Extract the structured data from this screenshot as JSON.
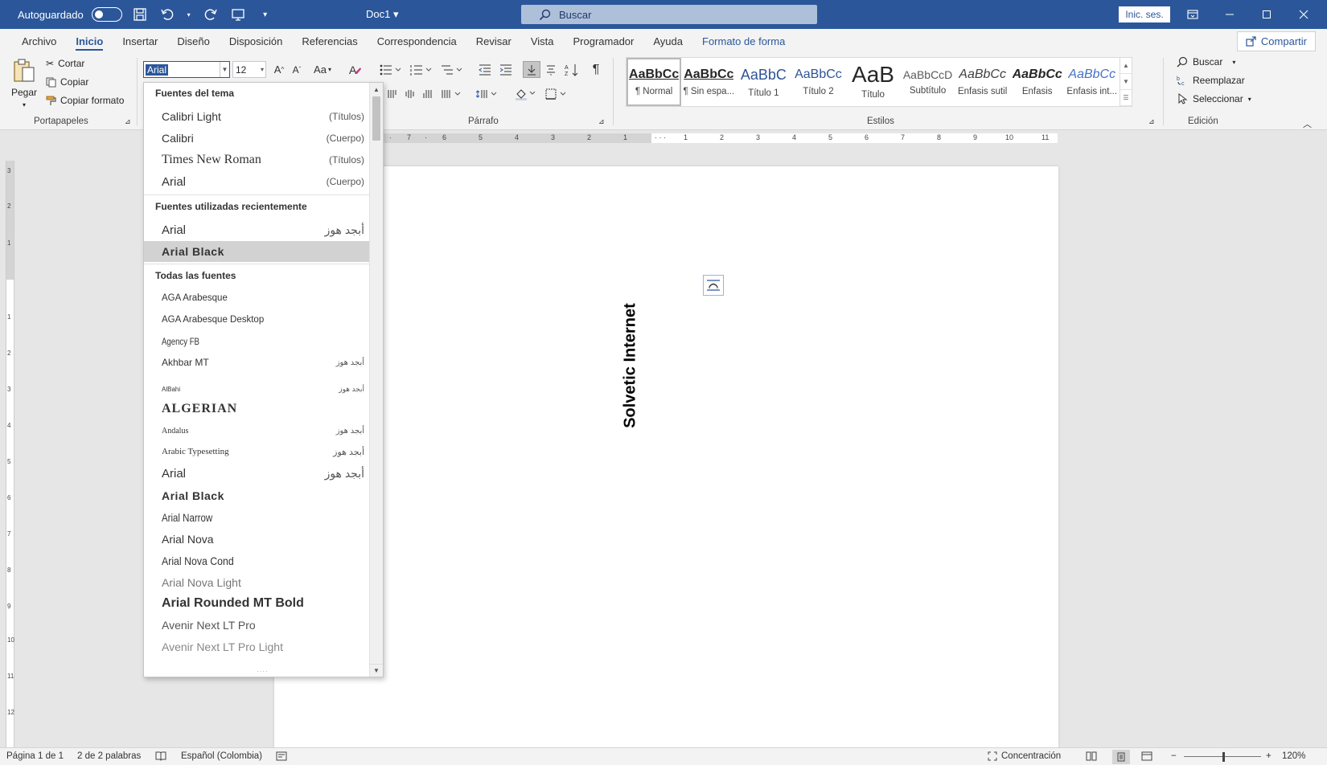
{
  "titlebar": {
    "autosave_label": "Autoguardado",
    "doc_title": "Doc1",
    "search_label": "Buscar",
    "signin_label": "Inic. ses."
  },
  "tabs": {
    "items": [
      "Archivo",
      "Inicio",
      "Insertar",
      "Diseño",
      "Disposición",
      "Referencias",
      "Correspondencia",
      "Revisar",
      "Vista",
      "Programador",
      "Ayuda",
      "Formato de forma"
    ],
    "share_label": "Compartir"
  },
  "ribbon": {
    "clipboard": {
      "paste": "Pegar",
      "cut": "Cortar",
      "copy": "Copiar",
      "format_painter": "Copiar formato",
      "label": "Portapapeles"
    },
    "font": {
      "current_font": "Arial",
      "current_size": "12",
      "change_case": "Aa"
    },
    "paragraph_label": "Párrafo",
    "styles": {
      "label": "Estilos",
      "items": [
        {
          "preview": "AaBbCc",
          "name": "¶ Normal"
        },
        {
          "preview": "AaBbCc",
          "name": "¶ Sin espa..."
        },
        {
          "preview": "AaBbC",
          "name": "Título 1"
        },
        {
          "preview": "AaBbCc",
          "name": "Título 2"
        },
        {
          "preview": "AaB",
          "name": "Título"
        },
        {
          "preview": "AaBbCcD",
          "name": "Subtítulo"
        },
        {
          "preview": "AaBbCc",
          "name": "Énfasis sutil"
        },
        {
          "preview": "AaBbCc",
          "name": "Énfasis"
        },
        {
          "preview": "AaBbCc",
          "name": "Énfasis int..."
        }
      ]
    },
    "editing": {
      "find": "Buscar",
      "replace": "Reemplazar",
      "select": "Seleccionar",
      "label": "Edición"
    }
  },
  "font_dropdown": {
    "theme_header": "Fuentes del tema",
    "theme_fonts": [
      {
        "name": "Calibri Light",
        "tag": "(Títulos)"
      },
      {
        "name": "Calibri",
        "tag": "(Cuerpo)"
      },
      {
        "name": "Times New Roman",
        "tag": "(Títulos)"
      },
      {
        "name": "Arial",
        "tag": "(Cuerpo)"
      }
    ],
    "recent_header": "Fuentes utilizadas recientemente",
    "recent_fonts": [
      {
        "name": "Arial",
        "tag": "أبجد هوز"
      },
      {
        "name": "Arial Black",
        "tag": ""
      }
    ],
    "all_header": "Todas las fuentes",
    "all_fonts": [
      {
        "name": "AGA Arabesque",
        "tag": ""
      },
      {
        "name": "AGA Arabesque Desktop",
        "tag": ""
      },
      {
        "name": "Agency FB",
        "tag": ""
      },
      {
        "name": "Akhbar MT",
        "tag": "أبجد هوز"
      },
      {
        "name": "AlBahi",
        "tag": "أبجد هوز"
      },
      {
        "name": "ALGERIAN",
        "tag": ""
      },
      {
        "name": "Andalus",
        "tag": "أبجد هوز"
      },
      {
        "name": "Arabic Typesetting",
        "tag": "أبجد هوز"
      },
      {
        "name": "Arial",
        "tag": "أبجد هوز"
      },
      {
        "name": "Arial Black",
        "tag": ""
      },
      {
        "name": "Arial Narrow",
        "tag": ""
      },
      {
        "name": "Arial Nova",
        "tag": ""
      },
      {
        "name": "Arial Nova Cond",
        "tag": ""
      },
      {
        "name": "Arial Nova Light",
        "tag": ""
      },
      {
        "name": "Arial Rounded MT Bold",
        "tag": ""
      },
      {
        "name": "Avenir Next LT Pro",
        "tag": ""
      },
      {
        "name": "Avenir Next LT Pro Light",
        "tag": ""
      }
    ]
  },
  "document": {
    "vertical_text": "Solvetic Internet"
  },
  "statusbar": {
    "page": "Página 1 de 1",
    "words": "2 de 2 palabras",
    "language": "Español (Colombia)",
    "focus": "Concentración",
    "zoom": "120%"
  },
  "colors": {
    "accent": "#2b579a",
    "ribbon_bg": "#f3f3f3",
    "canvas_bg": "#e6e6e6"
  }
}
